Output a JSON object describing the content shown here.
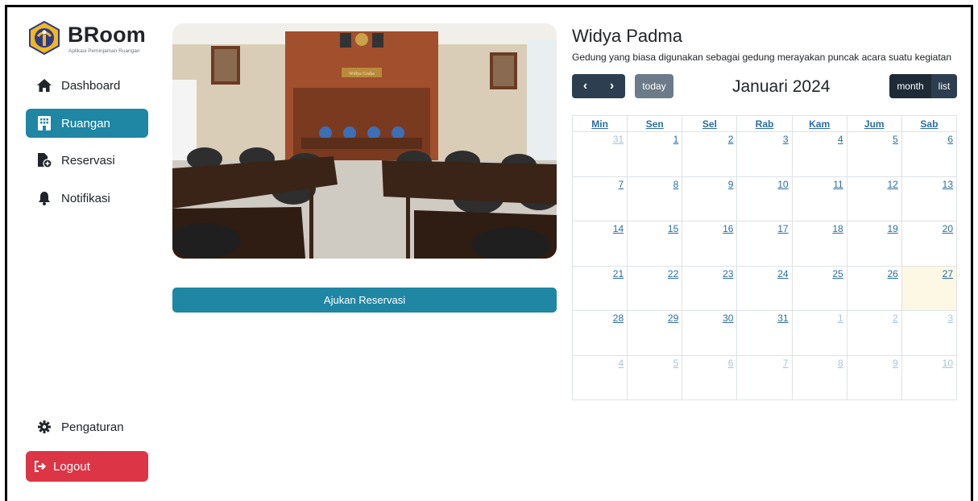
{
  "brand": {
    "title": "BRoom",
    "subtitle": "Aplikasi Peminjaman Ruangan"
  },
  "sidebar": {
    "items": [
      {
        "label": "Dashboard",
        "icon": "home-icon",
        "active": false
      },
      {
        "label": "Ruangan",
        "icon": "building-icon",
        "active": true
      },
      {
        "label": "Reservasi",
        "icon": "file-plus-icon",
        "active": false
      },
      {
        "label": "Notifikasi",
        "icon": "bell-icon",
        "active": false
      }
    ],
    "settings_label": "Pengaturan",
    "logout_label": "Logout"
  },
  "room": {
    "name": "Widya Padma",
    "description": "Gedung yang biasa digunakan sebagai gedung merayakan puncak acara suatu kegiatan",
    "reserve_button": "Ajukan Reservasi",
    "photo_sign": "Widya Graha"
  },
  "calendar": {
    "title": "Januari 2024",
    "prev_label": "‹",
    "next_label": "›",
    "today_label": "today",
    "view_month_label": "month",
    "view_list_label": "list",
    "weekdays": [
      "Min",
      "Sen",
      "Sel",
      "Rab",
      "Kam",
      "Jum",
      "Sab"
    ],
    "weeks": [
      [
        "31",
        "1",
        "2",
        "3",
        "4",
        "5",
        "6"
      ],
      [
        "7",
        "8",
        "9",
        "10",
        "11",
        "12",
        "13"
      ],
      [
        "14",
        "15",
        "16",
        "17",
        "18",
        "19",
        "20"
      ],
      [
        "21",
        "22",
        "23",
        "24",
        "25",
        "26",
        "27"
      ],
      [
        "28",
        "29",
        "30",
        "31",
        "1",
        "2",
        "3"
      ],
      [
        "4",
        "5",
        "6",
        "7",
        "8",
        "9",
        "10"
      ]
    ],
    "today": "27"
  },
  "colors": {
    "primary": "#1f86a3",
    "danger": "#dc3545",
    "calendar_dark": "#2c3e50",
    "today_highlight": "#fcf8e3"
  }
}
